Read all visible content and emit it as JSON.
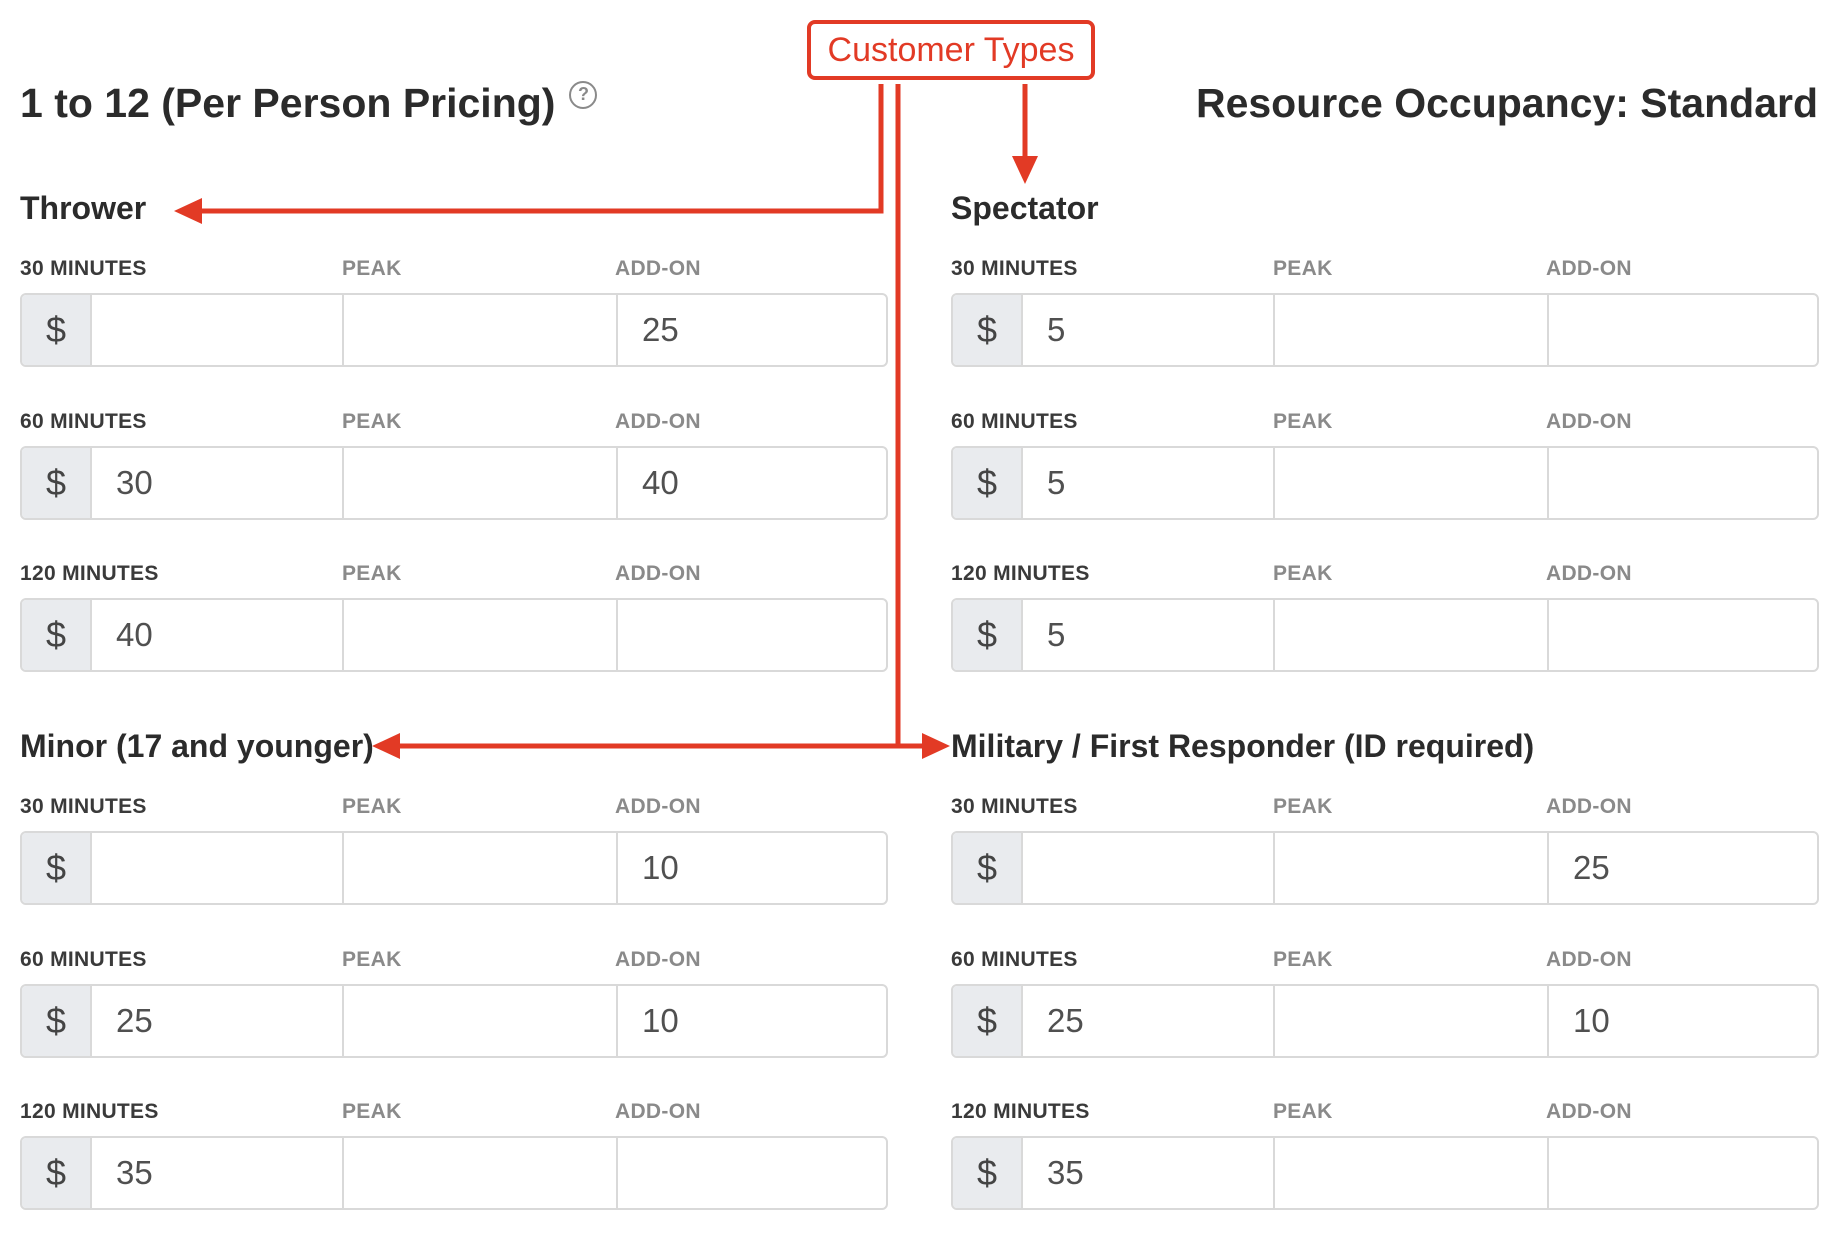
{
  "header": {
    "title": "1 to 12 (Per Person Pricing)",
    "help_icon": "?",
    "occupancy": "Resource Occupancy: Standard"
  },
  "annotation": {
    "callout_label": "Customer Types",
    "color": "#e23a25"
  },
  "field_labels": {
    "peak": "PEAK",
    "addon": "ADD-ON",
    "currency": "$"
  },
  "sections": [
    {
      "title": "Thrower",
      "rows": [
        {
          "duration": "30 MINUTES",
          "price": "",
          "peak": "",
          "addon": "25"
        },
        {
          "duration": "60 MINUTES",
          "price": "30",
          "peak": "",
          "addon": "40"
        },
        {
          "duration": "120 MINUTES",
          "price": "40",
          "peak": "",
          "addon": ""
        }
      ]
    },
    {
      "title": "Spectator",
      "rows": [
        {
          "duration": "30 MINUTES",
          "price": "5",
          "peak": "",
          "addon": ""
        },
        {
          "duration": "60 MINUTES",
          "price": "5",
          "peak": "",
          "addon": ""
        },
        {
          "duration": "120 MINUTES",
          "price": "5",
          "peak": "",
          "addon": ""
        }
      ]
    },
    {
      "title": "Minor (17 and younger)",
      "rows": [
        {
          "duration": "30 MINUTES",
          "price": "",
          "peak": "",
          "addon": "10"
        },
        {
          "duration": "60 MINUTES",
          "price": "25",
          "peak": "",
          "addon": "10"
        },
        {
          "duration": "120 MINUTES",
          "price": "35",
          "peak": "",
          "addon": ""
        }
      ]
    },
    {
      "title": "Military / First Responder (ID required)",
      "rows": [
        {
          "duration": "30 MINUTES",
          "price": "",
          "peak": "",
          "addon": "25"
        },
        {
          "duration": "60 MINUTES",
          "price": "25",
          "peak": "",
          "addon": "10"
        },
        {
          "duration": "120 MINUTES",
          "price": "35",
          "peak": "",
          "addon": ""
        }
      ]
    }
  ]
}
